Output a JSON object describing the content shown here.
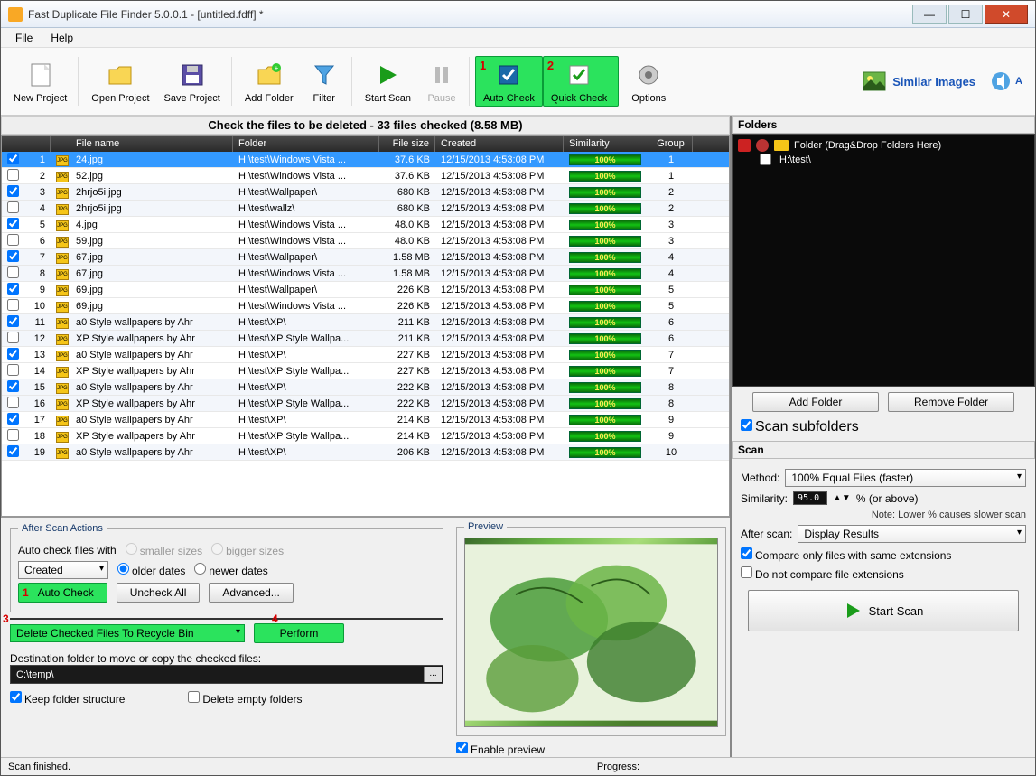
{
  "title": "Fast Duplicate File Finder 5.0.0.1 - [untitled.fdff] *",
  "menu": {
    "file": "File",
    "help": "Help"
  },
  "toolbar": {
    "new_project": "New Project",
    "open_project": "Open Project",
    "save_project": "Save Project",
    "add_folder": "Add Folder",
    "filter": "Filter",
    "start_scan": "Start Scan",
    "pause": "Pause",
    "auto_check": "Auto Check",
    "quick_check": "Quick Check",
    "options": "Options",
    "similar_images": "Similar Images",
    "a": "A"
  },
  "check_header": "Check the files to be deleted - 33 files checked (8.58 MB)",
  "columns": {
    "file_name": "File name",
    "folder": "Folder",
    "file_size": "File size",
    "created": "Created",
    "similarity": "Similarity",
    "group": "Group"
  },
  "rows": [
    {
      "chk": true,
      "idx": 1,
      "name": "24.jpg",
      "folder": "H:\\test\\Windows Vista ...",
      "size": "37.6 KB",
      "created": "12/15/2013 4:53:08 PM",
      "sim": "100%",
      "grp": 1,
      "sel": true
    },
    {
      "chk": false,
      "idx": 2,
      "name": "52.jpg",
      "folder": "H:\\test\\Windows Vista ...",
      "size": "37.6 KB",
      "created": "12/15/2013 4:53:08 PM",
      "sim": "100%",
      "grp": 1
    },
    {
      "chk": true,
      "idx": 3,
      "name": "2hrjo5i.jpg",
      "folder": "H:\\test\\Wallpaper\\",
      "size": "680 KB",
      "created": "12/15/2013 4:53:08 PM",
      "sim": "100%",
      "grp": 2
    },
    {
      "chk": false,
      "idx": 4,
      "name": "2hrjo5i.jpg",
      "folder": "H:\\test\\wallz\\",
      "size": "680 KB",
      "created": "12/15/2013 4:53:08 PM",
      "sim": "100%",
      "grp": 2
    },
    {
      "chk": true,
      "idx": 5,
      "name": "4.jpg",
      "folder": "H:\\test\\Windows Vista ...",
      "size": "48.0 KB",
      "created": "12/15/2013 4:53:08 PM",
      "sim": "100%",
      "grp": 3
    },
    {
      "chk": false,
      "idx": 6,
      "name": "59.jpg",
      "folder": "H:\\test\\Windows Vista ...",
      "size": "48.0 KB",
      "created": "12/15/2013 4:53:08 PM",
      "sim": "100%",
      "grp": 3
    },
    {
      "chk": true,
      "idx": 7,
      "name": "67.jpg",
      "folder": "H:\\test\\Wallpaper\\",
      "size": "1.58 MB",
      "created": "12/15/2013 4:53:08 PM",
      "sim": "100%",
      "grp": 4
    },
    {
      "chk": false,
      "idx": 8,
      "name": "67.jpg",
      "folder": "H:\\test\\Windows Vista ...",
      "size": "1.58 MB",
      "created": "12/15/2013 4:53:08 PM",
      "sim": "100%",
      "grp": 4
    },
    {
      "chk": true,
      "idx": 9,
      "name": "69.jpg",
      "folder": "H:\\test\\Wallpaper\\",
      "size": "226 KB",
      "created": "12/15/2013 4:53:08 PM",
      "sim": "100%",
      "grp": 5
    },
    {
      "chk": false,
      "idx": 10,
      "name": "69.jpg",
      "folder": "H:\\test\\Windows Vista ...",
      "size": "226 KB",
      "created": "12/15/2013 4:53:08 PM",
      "sim": "100%",
      "grp": 5
    },
    {
      "chk": true,
      "idx": 11,
      "name": "a0 Style wallpapers by Ahr",
      "folder": "H:\\test\\XP\\",
      "size": "211 KB",
      "created": "12/15/2013 4:53:08 PM",
      "sim": "100%",
      "grp": 6
    },
    {
      "chk": false,
      "idx": 12,
      "name": "XP Style wallpapers by Ahr",
      "folder": "H:\\test\\XP Style Wallpa...",
      "size": "211 KB",
      "created": "12/15/2013 4:53:08 PM",
      "sim": "100%",
      "grp": 6
    },
    {
      "chk": true,
      "idx": 13,
      "name": "a0 Style wallpapers by Ahr",
      "folder": "H:\\test\\XP\\",
      "size": "227 KB",
      "created": "12/15/2013 4:53:08 PM",
      "sim": "100%",
      "grp": 7
    },
    {
      "chk": false,
      "idx": 14,
      "name": "XP Style wallpapers by Ahr",
      "folder": "H:\\test\\XP Style Wallpa...",
      "size": "227 KB",
      "created": "12/15/2013 4:53:08 PM",
      "sim": "100%",
      "grp": 7
    },
    {
      "chk": true,
      "idx": 15,
      "name": "a0 Style wallpapers by Ahr",
      "folder": "H:\\test\\XP\\",
      "size": "222 KB",
      "created": "12/15/2013 4:53:08 PM",
      "sim": "100%",
      "grp": 8
    },
    {
      "chk": false,
      "idx": 16,
      "name": "XP Style wallpapers by Ahr",
      "folder": "H:\\test\\XP Style Wallpa...",
      "size": "222 KB",
      "created": "12/15/2013 4:53:08 PM",
      "sim": "100%",
      "grp": 8
    },
    {
      "chk": true,
      "idx": 17,
      "name": "a0 Style wallpapers by Ahr",
      "folder": "H:\\test\\XP\\",
      "size": "214 KB",
      "created": "12/15/2013 4:53:08 PM",
      "sim": "100%",
      "grp": 9
    },
    {
      "chk": false,
      "idx": 18,
      "name": "XP Style wallpapers by Ahr",
      "folder": "H:\\test\\XP Style Wallpa...",
      "size": "214 KB",
      "created": "12/15/2013 4:53:08 PM",
      "sim": "100%",
      "grp": 9
    },
    {
      "chk": true,
      "idx": 19,
      "name": "a0 Style wallpapers by Ahr",
      "folder": "H:\\test\\XP\\",
      "size": "206 KB",
      "created": "12/15/2013 4:53:08 PM",
      "sim": "100%",
      "grp": 10
    }
  ],
  "actions": {
    "legend": "After Scan Actions",
    "auto_check_label": "Auto check files with",
    "smaller": "smaller sizes",
    "bigger": "bigger sizes",
    "older": "older dates",
    "newer": "newer dates",
    "created_combo": "Created",
    "auto_check_btn": "Auto Check",
    "uncheck_all": "Uncheck All",
    "advanced": "Advanced...",
    "delete_combo": "Delete Checked Files To Recycle Bin",
    "perform": "Perform",
    "dest_label": "Destination folder to move or copy the checked files:",
    "dest_path": "C:\\temp\\",
    "keep_folder": "Keep folder structure",
    "delete_empty": "Delete empty folders"
  },
  "preview": {
    "legend": "Preview",
    "enable": "Enable preview"
  },
  "folders": {
    "header": "Folders",
    "root": "Folder (Drag&Drop Folders Here)",
    "item": "H:\\test\\",
    "add": "Add Folder",
    "remove": "Remove Folder",
    "scan_sub": "Scan subfolders"
  },
  "scan": {
    "header": "Scan",
    "method_label": "Method:",
    "method_val": "100% Equal Files (faster)",
    "sim_label": "Similarity:",
    "sim_val": "95.0",
    "sim_suffix": "%  (or above)",
    "note": "Note: Lower % causes slower scan",
    "after_label": "After scan:",
    "after_val": "Display Results",
    "compare_ext": "Compare only files with same extensions",
    "no_compare_ext": "Do not compare file extensions",
    "start_scan": "Start Scan"
  },
  "status": {
    "left": "Scan finished.",
    "progress": "Progress:"
  },
  "annotations": {
    "n1": "1",
    "n2": "2",
    "n3": "3",
    "n4": "4"
  }
}
